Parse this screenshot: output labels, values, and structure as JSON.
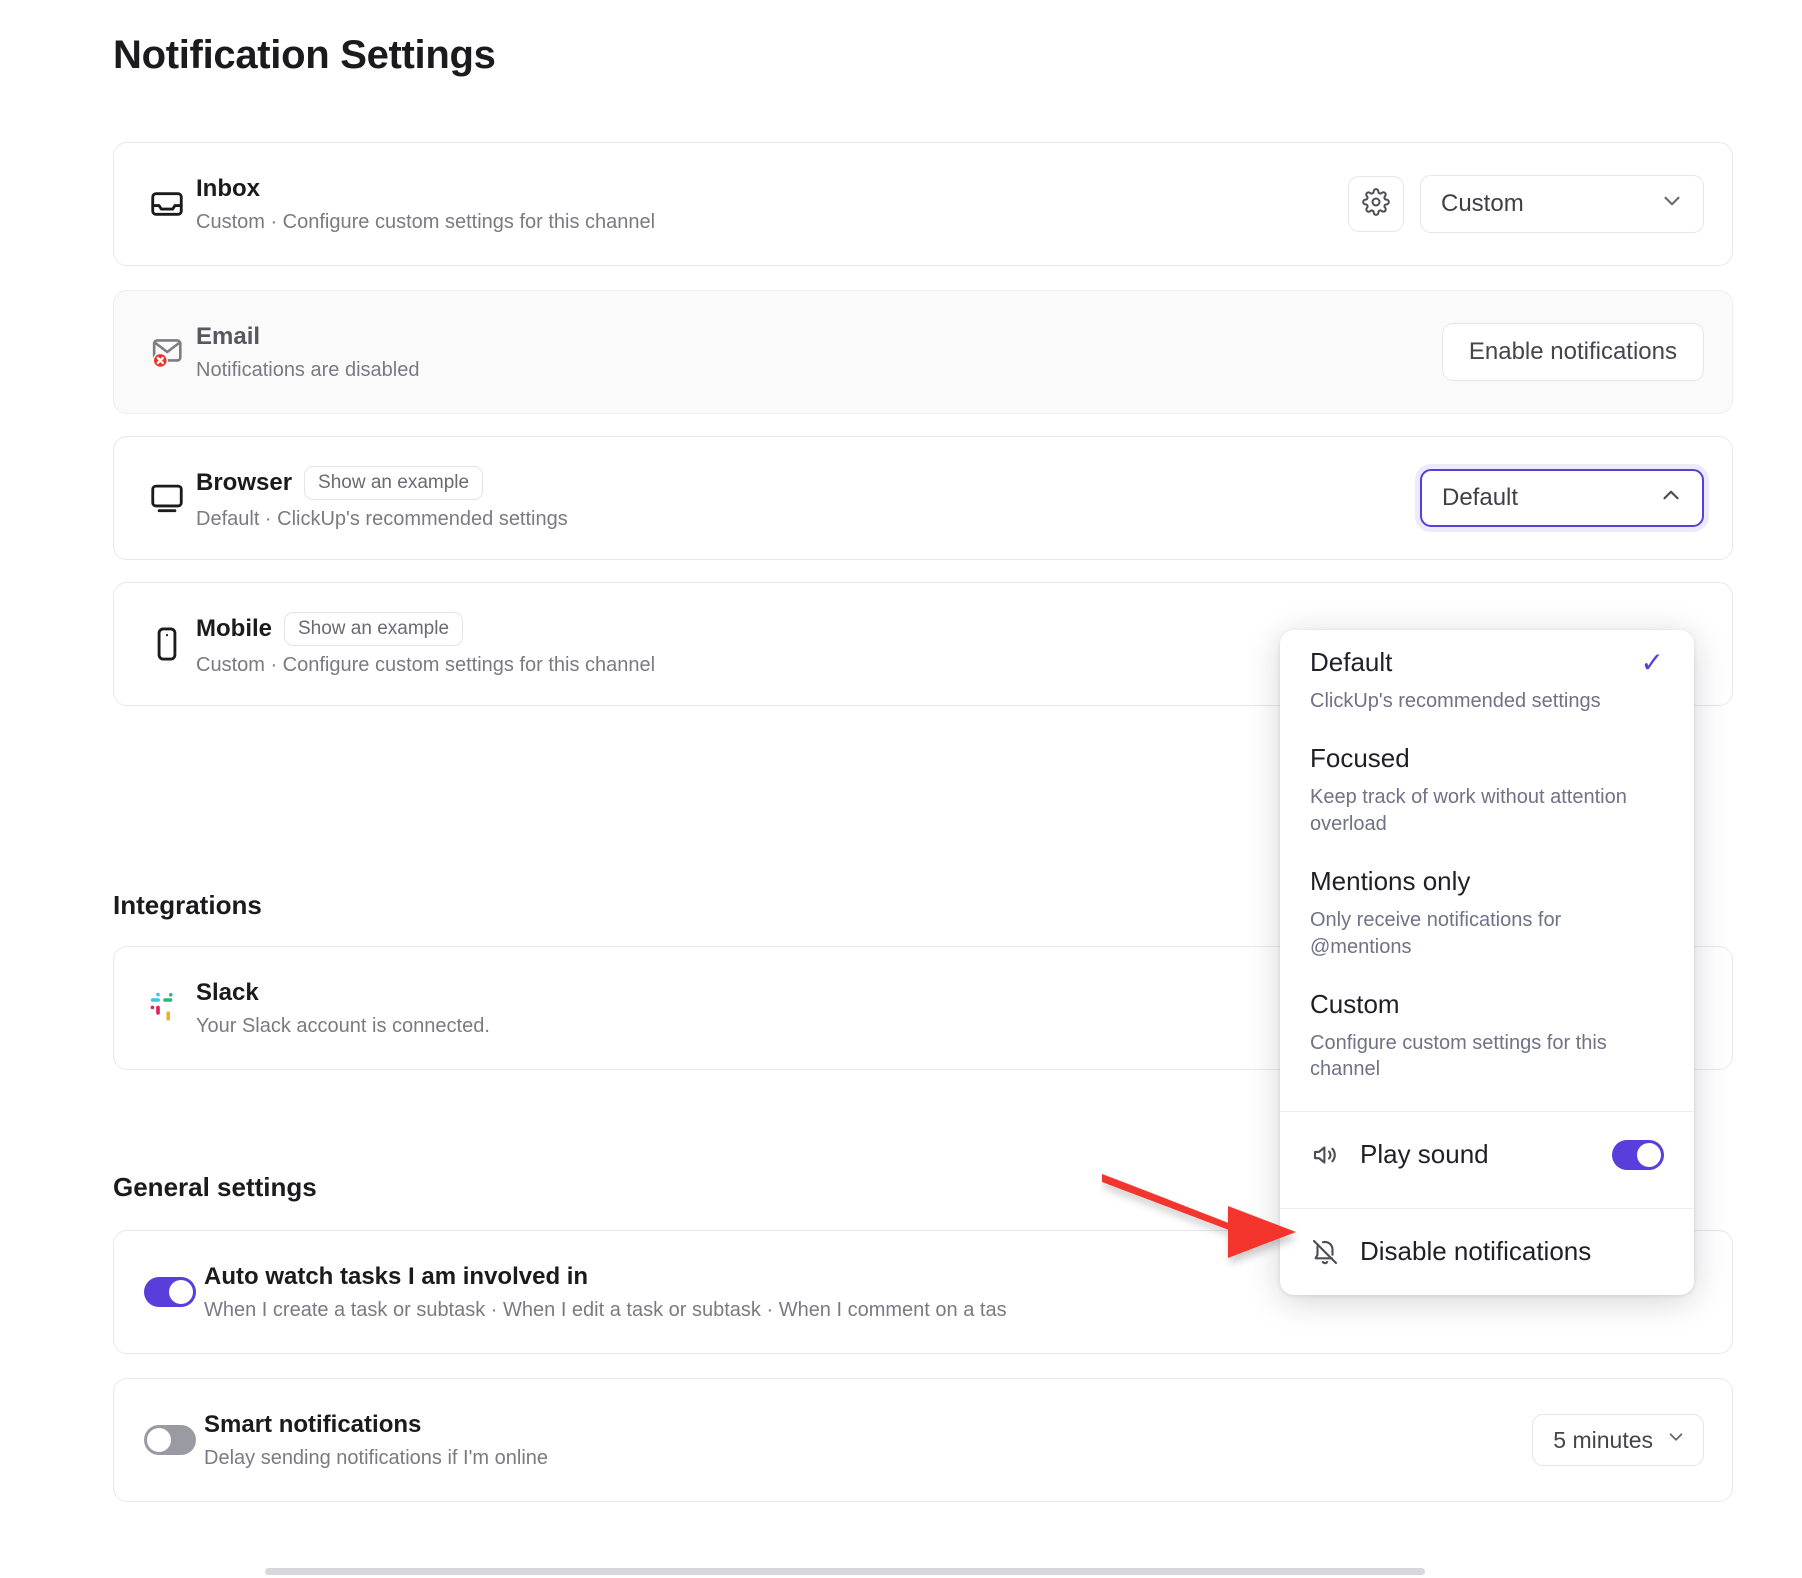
{
  "page": {
    "title": "Notification Settings"
  },
  "channels": [
    {
      "name": "Inbox",
      "icon": "inbox-icon",
      "subtitle": "Custom · Configure custom settings for this channel",
      "gear_label": "settings-gear",
      "select_value": "Custom",
      "chip": null,
      "button": null
    },
    {
      "name": "Email",
      "icon": "email-disabled-icon",
      "subtitle": "Notifications are disabled",
      "select_value": null,
      "chip": null,
      "button": "Enable notifications"
    },
    {
      "name": "Browser",
      "icon": "monitor-icon",
      "subtitle": "Default · ClickUp's recommended settings",
      "chip": "Show an example",
      "select_value": "Default",
      "button": null
    },
    {
      "name": "Mobile",
      "icon": "phone-icon",
      "subtitle": "Custom · Configure custom settings for this channel",
      "chip": "Show an example",
      "select_value": null,
      "button": null
    }
  ],
  "sections": {
    "integrations": "Integrations",
    "general": "General settings"
  },
  "integrations": [
    {
      "name": "Slack",
      "icon": "slack-icon",
      "subtitle": "Your Slack account is connected."
    }
  ],
  "general": [
    {
      "name": "Auto watch tasks I am involved in",
      "subtitle": "When I create a task or subtask · When I edit a task or subtask · When I comment on a tas",
      "toggle": "on",
      "select_value": null
    },
    {
      "name": "Smart notifications",
      "subtitle": "Delay sending notifications if I'm online",
      "toggle": "off",
      "select_value": "5 minutes"
    }
  ],
  "dropdown": {
    "options": [
      {
        "title": "Default",
        "desc": "ClickUp's recommended settings",
        "selected": true
      },
      {
        "title": "Focused",
        "desc": "Keep track of work without attention overload",
        "selected": false
      },
      {
        "title": "Mentions only",
        "desc": "Only receive notifications for @mentions",
        "selected": false
      },
      {
        "title": "Custom",
        "desc": "Configure custom settings for this channel",
        "selected": false
      }
    ],
    "play_sound": {
      "label": "Play sound",
      "icon": "speaker-icon",
      "toggle": "on"
    },
    "disable": {
      "label": "Disable notifications",
      "icon": "bell-off-icon"
    },
    "check_glyph": "✓"
  },
  "colors": {
    "accent": "#5b3ddb",
    "arrow": "#f4352e",
    "text": "#1b1b1e",
    "muted": "#7a7a83"
  }
}
